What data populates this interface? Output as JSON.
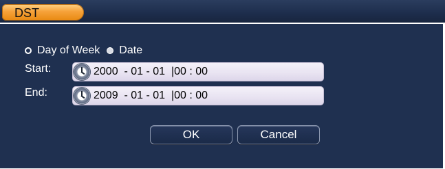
{
  "dialog": {
    "title": "DST"
  },
  "mode": {
    "options": [
      {
        "label": "Day of Week",
        "selected": false
      },
      {
        "label": "Date",
        "selected": true
      }
    ]
  },
  "start": {
    "label": "Start:",
    "value": "2000  - 01 - 01  |00 : 00"
  },
  "end": {
    "label": "End:",
    "value": "2009  - 01 - 01  |00 : 00"
  },
  "buttons": {
    "ok": "OK",
    "cancel": "Cancel"
  },
  "colors": {
    "panel": "#1f3050",
    "title_tab": "#f6a23a",
    "field": "#ebe6f4"
  }
}
